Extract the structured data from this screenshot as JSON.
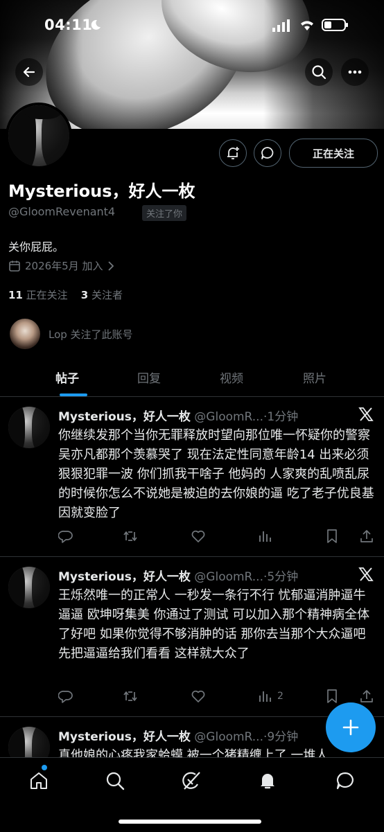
{
  "status_bar": {
    "time": "04:11"
  },
  "profile": {
    "display_name": "Mysterious，好人一枚",
    "handle": "@GloomRevenant4",
    "follows_you_badge": "关注了你",
    "bio": "关你屁屁。",
    "joined": "2026年5月 加入",
    "following_count": "11",
    "following_label": "正在关注",
    "followers_count": "3",
    "followers_label": "关注者",
    "mutual_text": "Lop 关注了此账号",
    "following_button": "正在关注"
  },
  "tabs": [
    {
      "label": "帖子",
      "active": true
    },
    {
      "label": "回复",
      "active": false
    },
    {
      "label": "视频",
      "active": false
    },
    {
      "label": "照片",
      "active": false
    }
  ],
  "posts": [
    {
      "name": "Mysterious，好人一枚",
      "handle": "@GloomR...",
      "time": "·1分钟",
      "text": "你继续发那个当你无罪释放时望向那位唯一怀疑你的警察 吴亦凡都那个羡慕哭了 现在法定性同意年龄14 出来必须狠狠犯罪一波 你们抓我干啥子 他妈的 人家爽的乱喷乱尿的时候你怎么不说她是被迫的去你娘的逼 吃了老子优良基因就变脸了",
      "views": ""
    },
    {
      "name": "Mysterious，好人一枚",
      "handle": "@GloomR...",
      "time": "·5分钟",
      "text": "王烁然唯一的正常人 一秒发一条行不行 忧郁逼消肿逼牛逼逼 欧坤呀集美 你通过了测试 可以加入那个精神病全体了好吧 如果你觉得不够消肿的话 那你去当那个大众逼吧 先把逼逼给我们看看 这样就大众了",
      "views": "2"
    },
    {
      "name": "Mysterious，好人一枚",
      "handle": "@GloomR...",
      "time": "·9分钟",
      "text": "真他娘的心疼我家蛤蟆 被一个猪精缠上了 一堆人",
      "views": ""
    }
  ],
  "colors": {
    "accent": "#1d9bf0",
    "muted": "#71767b",
    "text": "#e7e9ea",
    "divider": "#2f3336"
  },
  "icons": [
    "back-arrow-icon",
    "search-icon",
    "more-icon",
    "add-notification-icon",
    "message-icon",
    "calendar-icon",
    "chevron-right-icon",
    "x-logo-icon",
    "reply-icon",
    "repost-icon",
    "like-icon",
    "views-icon",
    "bookmark-icon",
    "share-icon",
    "compose-plus-icon",
    "home-icon",
    "explore-icon",
    "grok-icon",
    "notifications-icon",
    "messages-icon"
  ]
}
